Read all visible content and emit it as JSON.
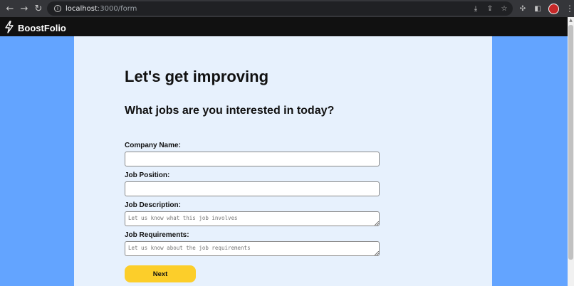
{
  "browser": {
    "url_host": "localhost",
    "url_path": ":3000/form"
  },
  "app": {
    "brand": "BoostFolio"
  },
  "form": {
    "title": "Let's get improving",
    "subtitle": "What jobs are you interested in today?",
    "company_label": "Company Name:",
    "company_value": "",
    "position_label": "Job Position:",
    "position_value": "",
    "description_label": "Job Description:",
    "description_placeholder": "Let us know what this job involves",
    "requirements_label": "Job Requirements:",
    "requirements_placeholder": "Let us know about the job requirements",
    "next_label": "Next"
  },
  "colors": {
    "page_background": "#63a4ff",
    "card_background": "#e7f1fd",
    "button": "#fcce2a",
    "header": "#111111"
  }
}
